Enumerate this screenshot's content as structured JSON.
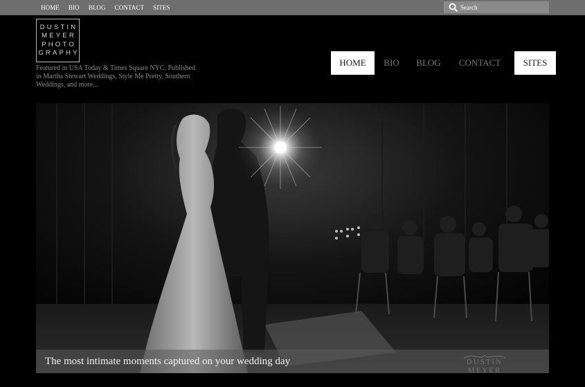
{
  "top_nav": {
    "items": [
      "HOME",
      "BIO",
      "BLOG",
      "CONTACT",
      "SITES"
    ]
  },
  "search": {
    "placeholder": "Search"
  },
  "logo": {
    "lines": [
      "DUSTIN",
      "MEYER",
      "PHOTO",
      "GRAPHY"
    ]
  },
  "tagline": "Featured in USA Today & Times Square NYC. Published in Martha Stewart Weddings, Style Me Pretty, Southern Weddings, and more...",
  "main_nav": {
    "items": [
      {
        "label": "HOME",
        "active": true
      },
      {
        "label": "BIO",
        "active": false
      },
      {
        "label": "BLOG",
        "active": false
      },
      {
        "label": "CONTACT",
        "active": false
      },
      {
        "label": "SITES",
        "active": true
      }
    ]
  },
  "hero": {
    "caption": "The most intimate moments captured on your wedding day",
    "watermark": "DUSTIN MEYER"
  },
  "colors": {
    "page_bg": "#000000",
    "topbar_bg": "#6e6e6e",
    "search_bg": "#8a8a8a",
    "nav_text": "#7a7a7a",
    "nav_active_bg": "#ffffff"
  }
}
